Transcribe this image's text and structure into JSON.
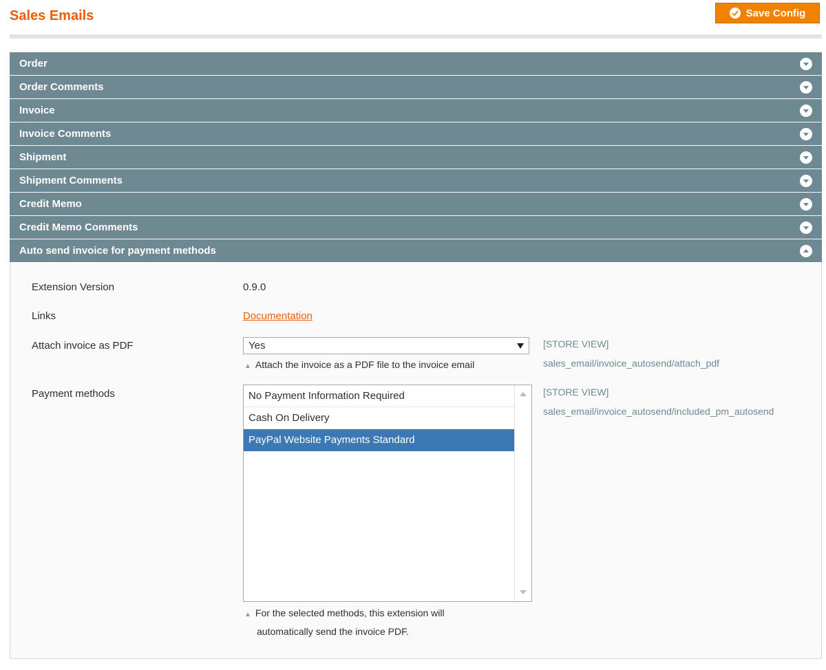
{
  "header": {
    "title": "Sales Emails",
    "save_label": "Save Config"
  },
  "sections": [
    {
      "label": "Order",
      "state": "collapsed"
    },
    {
      "label": "Order Comments",
      "state": "collapsed"
    },
    {
      "label": "Invoice",
      "state": "collapsed"
    },
    {
      "label": "Invoice Comments",
      "state": "collapsed"
    },
    {
      "label": "Shipment",
      "state": "collapsed"
    },
    {
      "label": "Shipment Comments",
      "state": "collapsed"
    },
    {
      "label": "Credit Memo",
      "state": "collapsed"
    },
    {
      "label": "Credit Memo Comments",
      "state": "collapsed"
    },
    {
      "label": "Auto send invoice for payment methods",
      "state": "expanded"
    }
  ],
  "fields": {
    "extension_version": {
      "label": "Extension Version",
      "value": "0.9.0"
    },
    "links": {
      "label": "Links",
      "link_text": "Documentation"
    },
    "attach_pdf": {
      "label": "Attach invoice as PDF",
      "value": "Yes",
      "note": "Attach the invoice as a PDF file to the invoice email",
      "scope": "[STORE VIEW]",
      "path": "sales_email/invoice_autosend/attach_pdf"
    },
    "payment_methods": {
      "label": "Payment methods",
      "options": [
        {
          "label": "No Payment Information Required",
          "selected": false
        },
        {
          "label": "Cash On Delivery",
          "selected": false
        },
        {
          "label": "PayPal Website Payments Standard",
          "selected": true
        }
      ],
      "note_line1": "For the selected methods, this extension will",
      "note_line2": "automatically send the invoice PDF.",
      "scope": "[STORE VIEW]",
      "path": "sales_email/invoice_autosend/included_pm_autosend"
    }
  },
  "colors": {
    "accent": "#eb5e00",
    "button": "#f18200",
    "section_header": "#6f8992",
    "selected_option": "#3c78b4"
  },
  "icons": {
    "save": "check-circle-icon",
    "collapsed": "chevron-down-circle-icon",
    "expanded": "chevron-up-circle-icon"
  }
}
